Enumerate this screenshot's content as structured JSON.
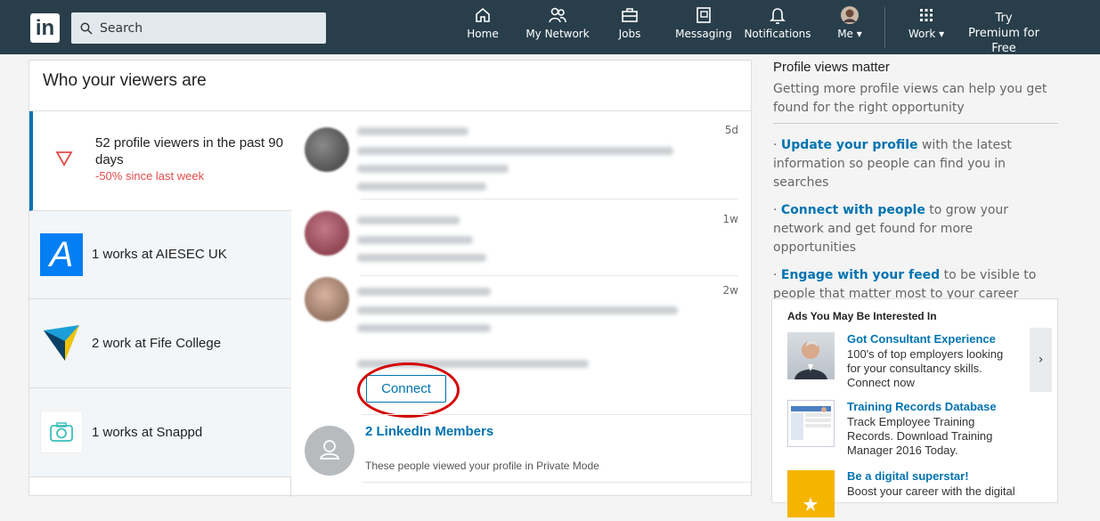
{
  "header": {
    "logo": "in",
    "search_placeholder": "Search",
    "nav": [
      {
        "label": "Home",
        "icon": "home-icon"
      },
      {
        "label": "My Network",
        "icon": "network-icon"
      },
      {
        "label": "Jobs",
        "icon": "jobs-icon"
      },
      {
        "label": "Messaging",
        "icon": "messaging-icon"
      },
      {
        "label": "Notifications",
        "icon": "bell-icon"
      },
      {
        "label": "Me ▾",
        "icon": "avatar"
      },
      {
        "label": "Work ▾",
        "icon": "grid-icon"
      }
    ],
    "premium": "Try Premium for Free"
  },
  "main": {
    "title": "Who your viewers are",
    "summary": {
      "count_text": "52 profile viewers in the past 90 days",
      "change_text": "-50% since last week"
    },
    "companies": [
      {
        "label": "1 works at AIESEC UK"
      },
      {
        "label": "2 work at Fife College"
      },
      {
        "label": "1 works at Snappd"
      }
    ],
    "viewers": [
      {
        "age": "5d"
      },
      {
        "age": "1w"
      },
      {
        "age": "2w"
      }
    ],
    "connect_label": "Connect",
    "private": {
      "title": "2 LinkedIn Members",
      "text": "These people viewed your profile in Private Mode"
    }
  },
  "sidebar": {
    "title": "Profile views matter",
    "subtitle": "Getting more profile views can help you get found for the right opportunity",
    "tips": [
      {
        "link": "Update your profile",
        "rest": " with the latest information so people can find you in searches"
      },
      {
        "link": "Connect with people",
        "rest": " to grow your network and get found for more opportunities"
      },
      {
        "link": "Engage with your feed",
        "rest": " to be visible to people that matter most to your career"
      }
    ]
  },
  "ads": {
    "title": "Ads You May Be Interested In",
    "items": [
      {
        "title": "Got Consultant Experience",
        "text": "100's of top employers looking for your consultancy skills. Connect now"
      },
      {
        "title": "Training Records Database",
        "text": "Track Employee Training Records. Download Training Manager 2016 Today."
      },
      {
        "title": "Be a digital superstar!",
        "text": "Boost your career with the digital"
      }
    ]
  },
  "colors": {
    "brand": "#283e4a",
    "link": "#0073b1",
    "alert": "#e34b4b"
  }
}
